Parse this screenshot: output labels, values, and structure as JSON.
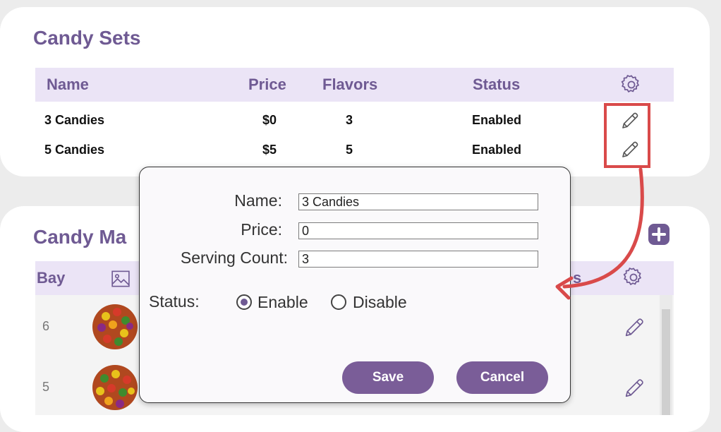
{
  "candy_sets": {
    "title": "Candy Sets",
    "columns": {
      "name": "Name",
      "price": "Price",
      "flavors": "Flavors",
      "status": "Status"
    },
    "rows": [
      {
        "name": "3 Candies",
        "price": "$0",
        "flavors": "3",
        "status": "Enabled"
      },
      {
        "name": "5 Candies",
        "price": "$5",
        "flavors": "5",
        "status": "Enabled"
      }
    ]
  },
  "candy_machine": {
    "title": "Candy Ma",
    "columns": {
      "bay": "Bay",
      "status_partial": "s"
    },
    "rows": [
      {
        "bay": "6"
      },
      {
        "bay": "5"
      }
    ]
  },
  "modal": {
    "name_label": "Name:",
    "name_value": "3 Candies",
    "price_label": "Price:",
    "price_value": "0",
    "serving_label": "Serving Count:",
    "serving_value": "3",
    "status_label": "Status:",
    "enable_label": "Enable",
    "disable_label": "Disable",
    "status_selected": "Enable",
    "save_label": "Save",
    "cancel_label": "Cancel"
  },
  "icons": {
    "settings": "gear-icon",
    "edit": "pencil-icon",
    "add": "plus-icon",
    "image": "image-icon"
  },
  "colors": {
    "accent": "#6f5a93",
    "header_bg": "#ebe4f6",
    "button": "#7a5d98",
    "annotation": "#d94a4a"
  }
}
